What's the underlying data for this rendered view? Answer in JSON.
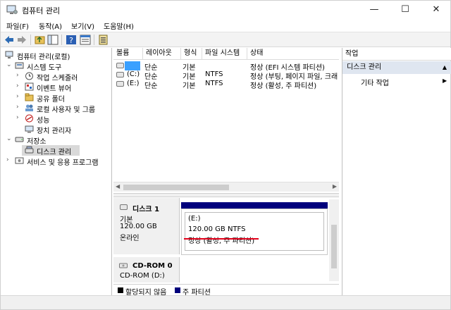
{
  "window": {
    "title": "컴퓨터 관리",
    "controls": {
      "minimize": "—",
      "maximize": "☐",
      "close": "✕"
    }
  },
  "menubar": [
    {
      "label": "파일(F)"
    },
    {
      "label": "동작(A)"
    },
    {
      "label": "보기(V)"
    },
    {
      "label": "도움말(H)"
    }
  ],
  "toolbar": [
    "back-icon",
    "forward-icon",
    "up-icon",
    "show-hide-tree-icon",
    "help-icon",
    "properties-icon",
    "export-list-icon"
  ],
  "tree": {
    "root": "컴퓨터 관리(로컬)",
    "system_tools": "시스템 도구",
    "task_scheduler": "작업 스케줄러",
    "event_viewer": "이벤트 뷰어",
    "shared_folders": "공유 폴더",
    "local_users": "로컬 사용자 및 그룹",
    "performance": "성능",
    "device_manager": "장치 관리자",
    "storage": "저장소",
    "disk_management": "디스크 관리",
    "services": "서비스 및 응용 프로그램"
  },
  "volume_list": {
    "columns": [
      "볼륨",
      "레이아웃",
      "형식",
      "파일 시스템",
      "상태"
    ],
    "rows": [
      {
        "volume": "",
        "layout": "단순",
        "type": "기본",
        "fs": "",
        "status": "정상 (EFI 시스템 파티션)"
      },
      {
        "volume": "(C:)",
        "layout": "단순",
        "type": "기본",
        "fs": "NTFS",
        "status": "정상 (부팅, 페이지 파일, 크래"
      },
      {
        "volume": "(E:)",
        "layout": "단순",
        "type": "기본",
        "fs": "NTFS",
        "status": "정상 (활성, 주 파티션)"
      }
    ]
  },
  "disks": [
    {
      "name": "디스크 1",
      "kind": "기본",
      "size": "120.00 GB",
      "state": "온라인",
      "partition": {
        "letter": "(E:)",
        "size_fs": "120.00 GB NTFS",
        "status": "정상 (활성, 주 파티션)"
      }
    },
    {
      "name": "CD-ROM 0",
      "kind": "CD-ROM (D:)"
    }
  ],
  "legend": {
    "unallocated": "할당되지 않음",
    "primary": "주 파티션"
  },
  "actions": {
    "header": "작업",
    "section": "디스크 관리",
    "more": "기타 작업"
  },
  "colors": {
    "primary_partition": "#00007c",
    "unallocated": "#000000",
    "selected_volume": "#3aa0ff",
    "underline": "#e2001a",
    "actions_section": "#dfe6f0"
  }
}
